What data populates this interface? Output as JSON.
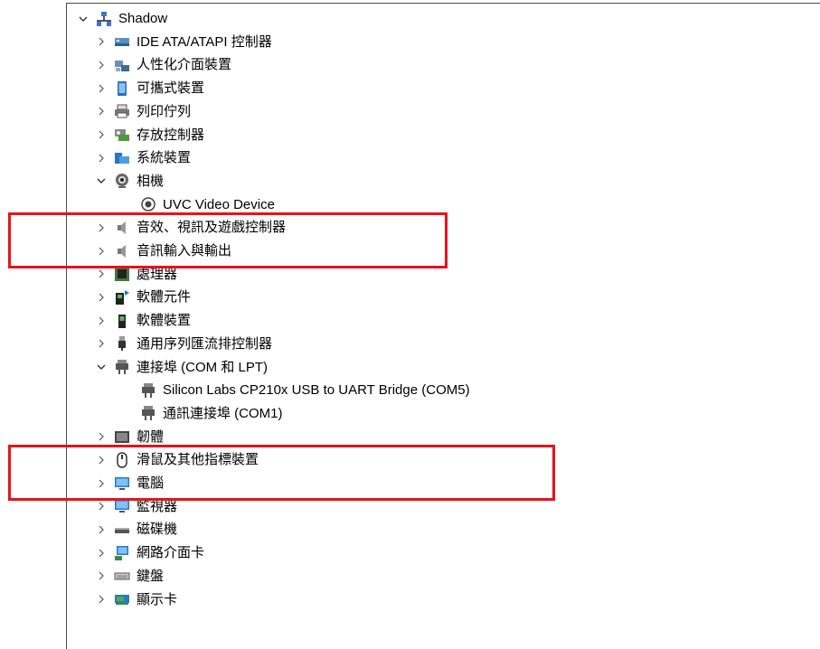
{
  "tree": {
    "root": {
      "label": "Shadow",
      "expanded": true,
      "icon": "computer-tree-icon"
    },
    "categories": [
      {
        "key": "ide",
        "label": "IDE ATA/ATAPI 控制器",
        "icon": "ide-controller-icon",
        "expanded": false
      },
      {
        "key": "hid",
        "label": "人性化介面裝置",
        "icon": "hid-device-icon",
        "expanded": false
      },
      {
        "key": "portable",
        "label": "可攜式裝置",
        "icon": "portable-device-icon",
        "expanded": false
      },
      {
        "key": "printq",
        "label": "列印佇列",
        "icon": "printer-icon",
        "expanded": false
      },
      {
        "key": "storage",
        "label": "存放控制器",
        "icon": "storage-controller-icon",
        "expanded": false
      },
      {
        "key": "system",
        "label": "系統裝置",
        "icon": "system-device-icon",
        "expanded": false
      },
      {
        "key": "camera",
        "label": "相機",
        "icon": "camera-icon",
        "expanded": true,
        "children": [
          {
            "label": "UVC Video Device",
            "icon": "webcam-icon"
          }
        ]
      },
      {
        "key": "sound",
        "label": "音效、視訊及遊戲控制器",
        "icon": "speaker-icon",
        "expanded": false
      },
      {
        "key": "audio",
        "label": "音訊輸入與輸出",
        "icon": "speaker-icon",
        "expanded": false
      },
      {
        "key": "cpu",
        "label": "處理器",
        "icon": "processor-icon",
        "expanded": false
      },
      {
        "key": "swcomp",
        "label": "軟體元件",
        "icon": "software-component-icon",
        "expanded": false
      },
      {
        "key": "swdev",
        "label": "軟體裝置",
        "icon": "software-device-icon",
        "expanded": false
      },
      {
        "key": "usb",
        "label": "通用序列匯流排控制器",
        "icon": "usb-icon",
        "expanded": false
      },
      {
        "key": "ports",
        "label": "連接埠 (COM 和 LPT)",
        "icon": "port-icon",
        "expanded": true,
        "children": [
          {
            "label": "Silicon Labs CP210x USB to UART Bridge (COM5)",
            "icon": "port-icon"
          },
          {
            "label": "通訊連接埠 (COM1)",
            "icon": "port-icon"
          }
        ]
      },
      {
        "key": "firmware",
        "label": "韌體",
        "icon": "firmware-icon",
        "expanded": false
      },
      {
        "key": "mouse",
        "label": "滑鼠及其他指標裝置",
        "icon": "mouse-icon",
        "expanded": false
      },
      {
        "key": "computer",
        "label": "電腦",
        "icon": "monitor-icon",
        "expanded": false
      },
      {
        "key": "monitors",
        "label": "監視器",
        "icon": "monitor-icon",
        "expanded": false
      },
      {
        "key": "disk",
        "label": "磁碟機",
        "icon": "disk-drive-icon",
        "expanded": false
      },
      {
        "key": "network",
        "label": "網路介面卡",
        "icon": "network-adapter-icon",
        "expanded": false
      },
      {
        "key": "keyboard",
        "label": "鍵盤",
        "icon": "keyboard-icon",
        "expanded": false
      },
      {
        "key": "display",
        "label": "顯示卡",
        "icon": "display-adapter-icon",
        "expanded": false
      }
    ]
  },
  "highlights": [
    {
      "covers": [
        "sound",
        "audio"
      ],
      "color": "#e8121b"
    },
    {
      "covers": [
        "mouse",
        "computer"
      ],
      "color": "#e8121b"
    }
  ]
}
